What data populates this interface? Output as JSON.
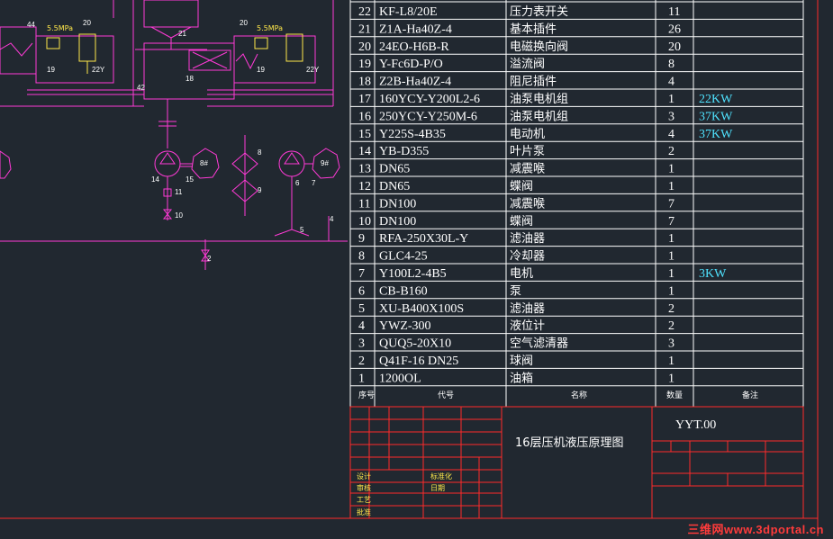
{
  "bom": {
    "rows": [
      {
        "no": "22",
        "code": "KF-L8/20E",
        "name": "压力表开关",
        "qty": "11",
        "note": ""
      },
      {
        "no": "21",
        "code": "Z1A-Ha40Z-4",
        "name": "基本插件",
        "qty": "26",
        "note": ""
      },
      {
        "no": "20",
        "code": "24EO-H6B-R",
        "name": "电磁换向阀",
        "qty": "20",
        "note": ""
      },
      {
        "no": "19",
        "code": "Y-Fc6D-P/O",
        "name": "溢流阀",
        "qty": "8",
        "note": ""
      },
      {
        "no": "18",
        "code": "Z2B-Ha40Z-4",
        "name": "阻尼插件",
        "qty": "4",
        "note": ""
      },
      {
        "no": "17",
        "code": "160YCY-Y200L2-6",
        "name": "油泵电机组",
        "qty": "1",
        "note": "22KW"
      },
      {
        "no": "16",
        "code": "250YCY-Y250M-6",
        "name": "油泵电机组",
        "qty": "3",
        "note": "37KW"
      },
      {
        "no": "15",
        "code": "Y225S-4B35",
        "name": "电动机",
        "qty": "4",
        "note": "37KW"
      },
      {
        "no": "14",
        "code": "YB-D355",
        "name": "叶片泵",
        "qty": "2",
        "note": ""
      },
      {
        "no": "13",
        "code": "DN65",
        "name": "减震喉",
        "qty": "1",
        "note": ""
      },
      {
        "no": "12",
        "code": "DN65",
        "name": "蝶阀",
        "qty": "1",
        "note": ""
      },
      {
        "no": "11",
        "code": "DN100",
        "name": "减震喉",
        "qty": "7",
        "note": ""
      },
      {
        "no": "10",
        "code": "DN100",
        "name": "蝶阀",
        "qty": "7",
        "note": ""
      },
      {
        "no": "9",
        "code": "RFA-250X30L-Y",
        "name": "滤油器",
        "qty": "1",
        "note": ""
      },
      {
        "no": "8",
        "code": "GLC4-25",
        "name": "冷却器",
        "qty": "1",
        "note": ""
      },
      {
        "no": "7",
        "code": "Y100L2-4B5",
        "name": "电机",
        "qty": "1",
        "note": "3KW"
      },
      {
        "no": "6",
        "code": "CB-B160",
        "name": "泵",
        "qty": "1",
        "note": ""
      },
      {
        "no": "5",
        "code": "XU-B400X100S",
        "name": "滤油器",
        "qty": "2",
        "note": ""
      },
      {
        "no": "4",
        "code": "YWZ-300",
        "name": "液位计",
        "qty": "2",
        "note": ""
      },
      {
        "no": "3",
        "code": "QUQ5-20X10",
        "name": "空气滤清器",
        "qty": "3",
        "note": ""
      },
      {
        "no": "2",
        "code": "Q41F-16  DN25",
        "name": "球阀",
        "qty": "1",
        "note": ""
      },
      {
        "no": "1",
        "code": "1200OL",
        "name": "油箱",
        "qty": "1",
        "note": ""
      }
    ],
    "headers": {
      "no": "序号",
      "code": "代号",
      "name": "名称",
      "qty": "数量",
      "note": "备注"
    }
  },
  "title_block": {
    "drawing_title": "16层压机液压原理图",
    "drawing_code": "YYT.00",
    "left_labels": [
      "设计",
      "审核",
      "工艺",
      "批准"
    ],
    "mid_labels": [
      "标准化",
      "日期"
    ]
  },
  "schematic": {
    "pressure_left": "5.5MPa",
    "pressure_right": "5.5MPa",
    "labels": [
      "44",
      "20",
      "19",
      "22Y",
      "21",
      "18",
      "42",
      "16",
      "20",
      "19",
      "22Y",
      "22",
      "14",
      "15",
      "11",
      "10",
      "8",
      "9",
      "6",
      "7",
      "5",
      "4",
      "2"
    ],
    "pump_marks": [
      "8#",
      "9#"
    ]
  },
  "watermark": "三维网www.3dportal.cn",
  "colors": {
    "background": "#212830",
    "table_line": "#ffffff",
    "frame": "#ff2a2a",
    "hydraulic": "#ff3ad6",
    "cyan": "#4fe3ff",
    "yellow": "#ffe84a"
  }
}
